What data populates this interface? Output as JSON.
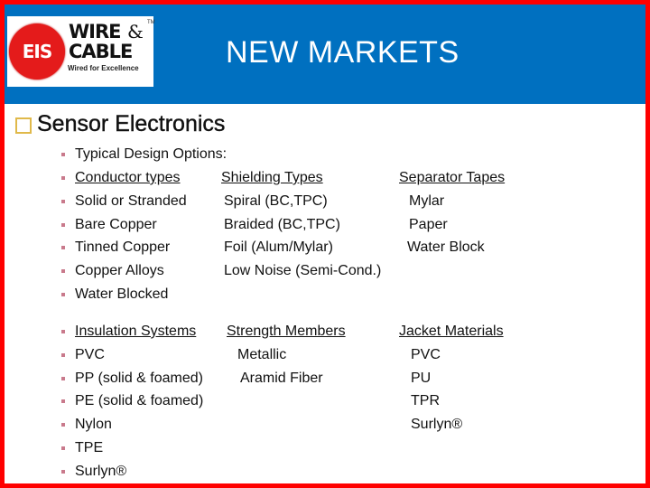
{
  "header": {
    "title": "NEW MARKETS",
    "logo": {
      "badge_text": "EIS",
      "line1": "WIRE",
      "ampersand": "&",
      "trademark": "TM",
      "line2": "CABLE",
      "tagline": "Wired for Excellence"
    }
  },
  "section": {
    "heading": "Sensor Electronics",
    "heading_bullet_icon": "hollow-square-icon"
  },
  "intro": "Typical Design Options:",
  "group1": {
    "headers": [
      "Conductor types",
      "Shielding Types",
      "Separator Tapes"
    ],
    "rows": [
      [
        "Solid or Stranded",
        "Spiral (BC,TPC)",
        "Mylar"
      ],
      [
        "Bare Copper",
        "Braided (BC,TPC)",
        "Paper"
      ],
      [
        "Tinned Copper",
        "Foil (Alum/Mylar)",
        "Water Block"
      ],
      [
        "Copper Alloys",
        "Low Noise (Semi-Cond.)",
        ""
      ],
      [
        "Water Blocked",
        "",
        ""
      ]
    ]
  },
  "group2": {
    "headers": [
      "Insulation Systems",
      "Strength Members",
      "Jacket Materials"
    ],
    "rows": [
      [
        "PVC",
        "Metallic",
        "PVC"
      ],
      [
        "PP (solid & foamed)",
        "Aramid Fiber",
        "PU"
      ],
      [
        "PE (solid & foamed)",
        "",
        "TPR"
      ],
      [
        "Nylon",
        "",
        "Surlyn®"
      ],
      [
        "TPE",
        "",
        ""
      ],
      [
        "Surlyn®",
        "",
        ""
      ]
    ]
  },
  "colors": {
    "frame": "#ff0000",
    "header_bg": "#0070c0",
    "bullet": "#c97a8c",
    "heading_box": "#e0b94a"
  }
}
